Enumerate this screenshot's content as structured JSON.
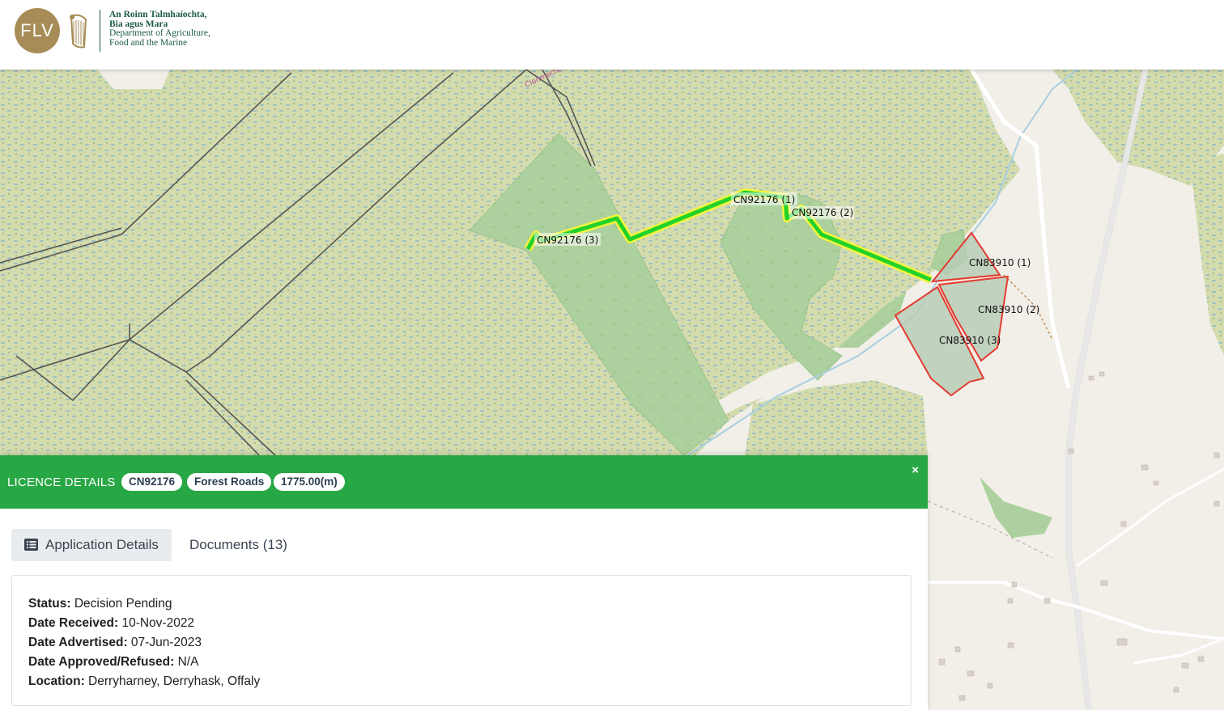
{
  "header": {
    "logo_text": "FLV",
    "dept_lines": [
      "An Roinn Talmhaíochta,",
      "Bia agus Mara",
      "Department of Agriculture,",
      "Food and the Marine"
    ]
  },
  "map": {
    "road_label": "Clonmacnoise",
    "labels": {
      "cn92176_1": "CN92176 (1)",
      "cn92176_2": "CN92176 (2)",
      "cn92176_3": "CN92176 (3)",
      "cn83910_1": "CN83910 (1)",
      "cn83910_2": "CN83910 (2)",
      "cn83910_3": "CN83910 (3)"
    },
    "colors": {
      "bog": "#d4dcae",
      "forest": "#add19e",
      "water": "#a8cfe0",
      "route_outer": "#f5f53c",
      "route_inner": "#22d22a",
      "plot_border": "#e53a2f"
    }
  },
  "panel": {
    "title": "LICENCE DETAILS",
    "badges": [
      "CN92176",
      "Forest Roads",
      "1775.00(m)"
    ],
    "close": "×",
    "tabs": [
      {
        "label": "Application Details",
        "icon": "list-icon",
        "active": true
      },
      {
        "label": "Documents (13)",
        "active": false
      }
    ],
    "details": [
      {
        "label": "Status:",
        "value": " Decision Pending"
      },
      {
        "label": "Date Received:",
        "value": " 10-Nov-2022"
      },
      {
        "label": "Date Advertised:",
        "value": " 07-Jun-2023"
      },
      {
        "label": "Date Approved/Refused:",
        "value": " N/A"
      },
      {
        "label": "Location:",
        "value": " Derryharney, Derryhask, Offaly"
      }
    ],
    "accent": "#28a745"
  }
}
